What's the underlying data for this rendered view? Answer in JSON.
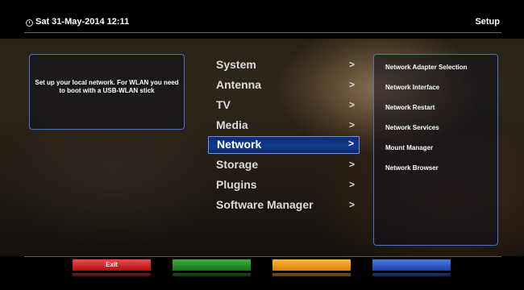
{
  "header": {
    "datetime": "Sat 31-May-2014 12:11",
    "title": "Setup"
  },
  "info": {
    "text": "Set up your local network. For WLAN you need to boot with a USB-WLAN stick"
  },
  "menu": {
    "items": [
      {
        "label": "System",
        "arrow": ">"
      },
      {
        "label": "Antenna",
        "arrow": ">"
      },
      {
        "label": "TV",
        "arrow": ">"
      },
      {
        "label": "Media",
        "arrow": ">"
      },
      {
        "label": "Network",
        "arrow": ">",
        "selected": true
      },
      {
        "label": "Storage",
        "arrow": ">"
      },
      {
        "label": "Plugins",
        "arrow": ">"
      },
      {
        "label": "Software Manager",
        "arrow": ">"
      }
    ]
  },
  "submenu": {
    "items": [
      "Network Adapter Selection",
      "Network Interface",
      "Network Restart",
      "Network Services",
      "Mount Manager",
      "Network Browser"
    ]
  },
  "buttons": {
    "red": "Exit",
    "green": "",
    "yellow": "",
    "blue": ""
  },
  "colors": {
    "selection": "#143a8f",
    "border": "#4f73c9",
    "red": "#e02a2a",
    "green": "#2a9a2a",
    "yellow": "#f5a020",
    "blue": "#2f5fc8"
  }
}
